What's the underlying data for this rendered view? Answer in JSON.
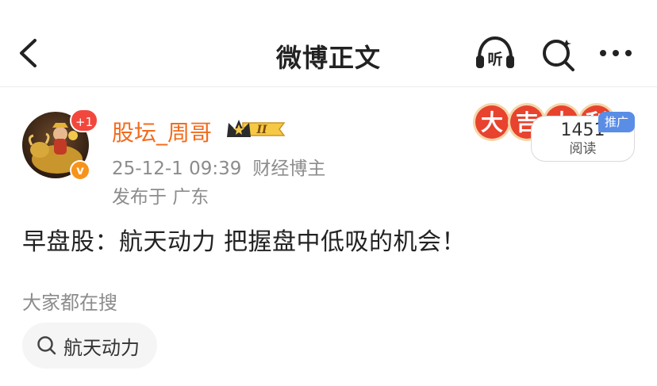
{
  "nav": {
    "title": "微博正文",
    "listen_label": "听",
    "icons": [
      "back-arrow-icon",
      "listen-headphones-icon",
      "search-icon",
      "more-dots-icon"
    ]
  },
  "post": {
    "author": {
      "name": "股坛_周哥",
      "avatar_badge": "+1",
      "verified_badge": "v",
      "vip_level": "II"
    },
    "timestamp": "25-12-1 09:39",
    "author_role": "财经博主",
    "location": "发布于 广东",
    "banner_text": [
      "大",
      "吉",
      "大",
      "利"
    ],
    "read_count": "1451",
    "read_label": "阅读",
    "promo_tag": "推广",
    "content": "早盘股：航天动力 把握盘中低吸的机会！"
  },
  "trending": {
    "label": "大家都在搜",
    "chips": [
      {
        "text": "航天动力",
        "icon": "search-icon"
      }
    ]
  },
  "colors": {
    "username": "#f26b1d",
    "badge_red": "#f2473d",
    "verified_orange": "#f7931a",
    "promo_blue": "#5a8de6",
    "meta_gray": "#8c8c8c",
    "banner_red": "#e8432e"
  }
}
